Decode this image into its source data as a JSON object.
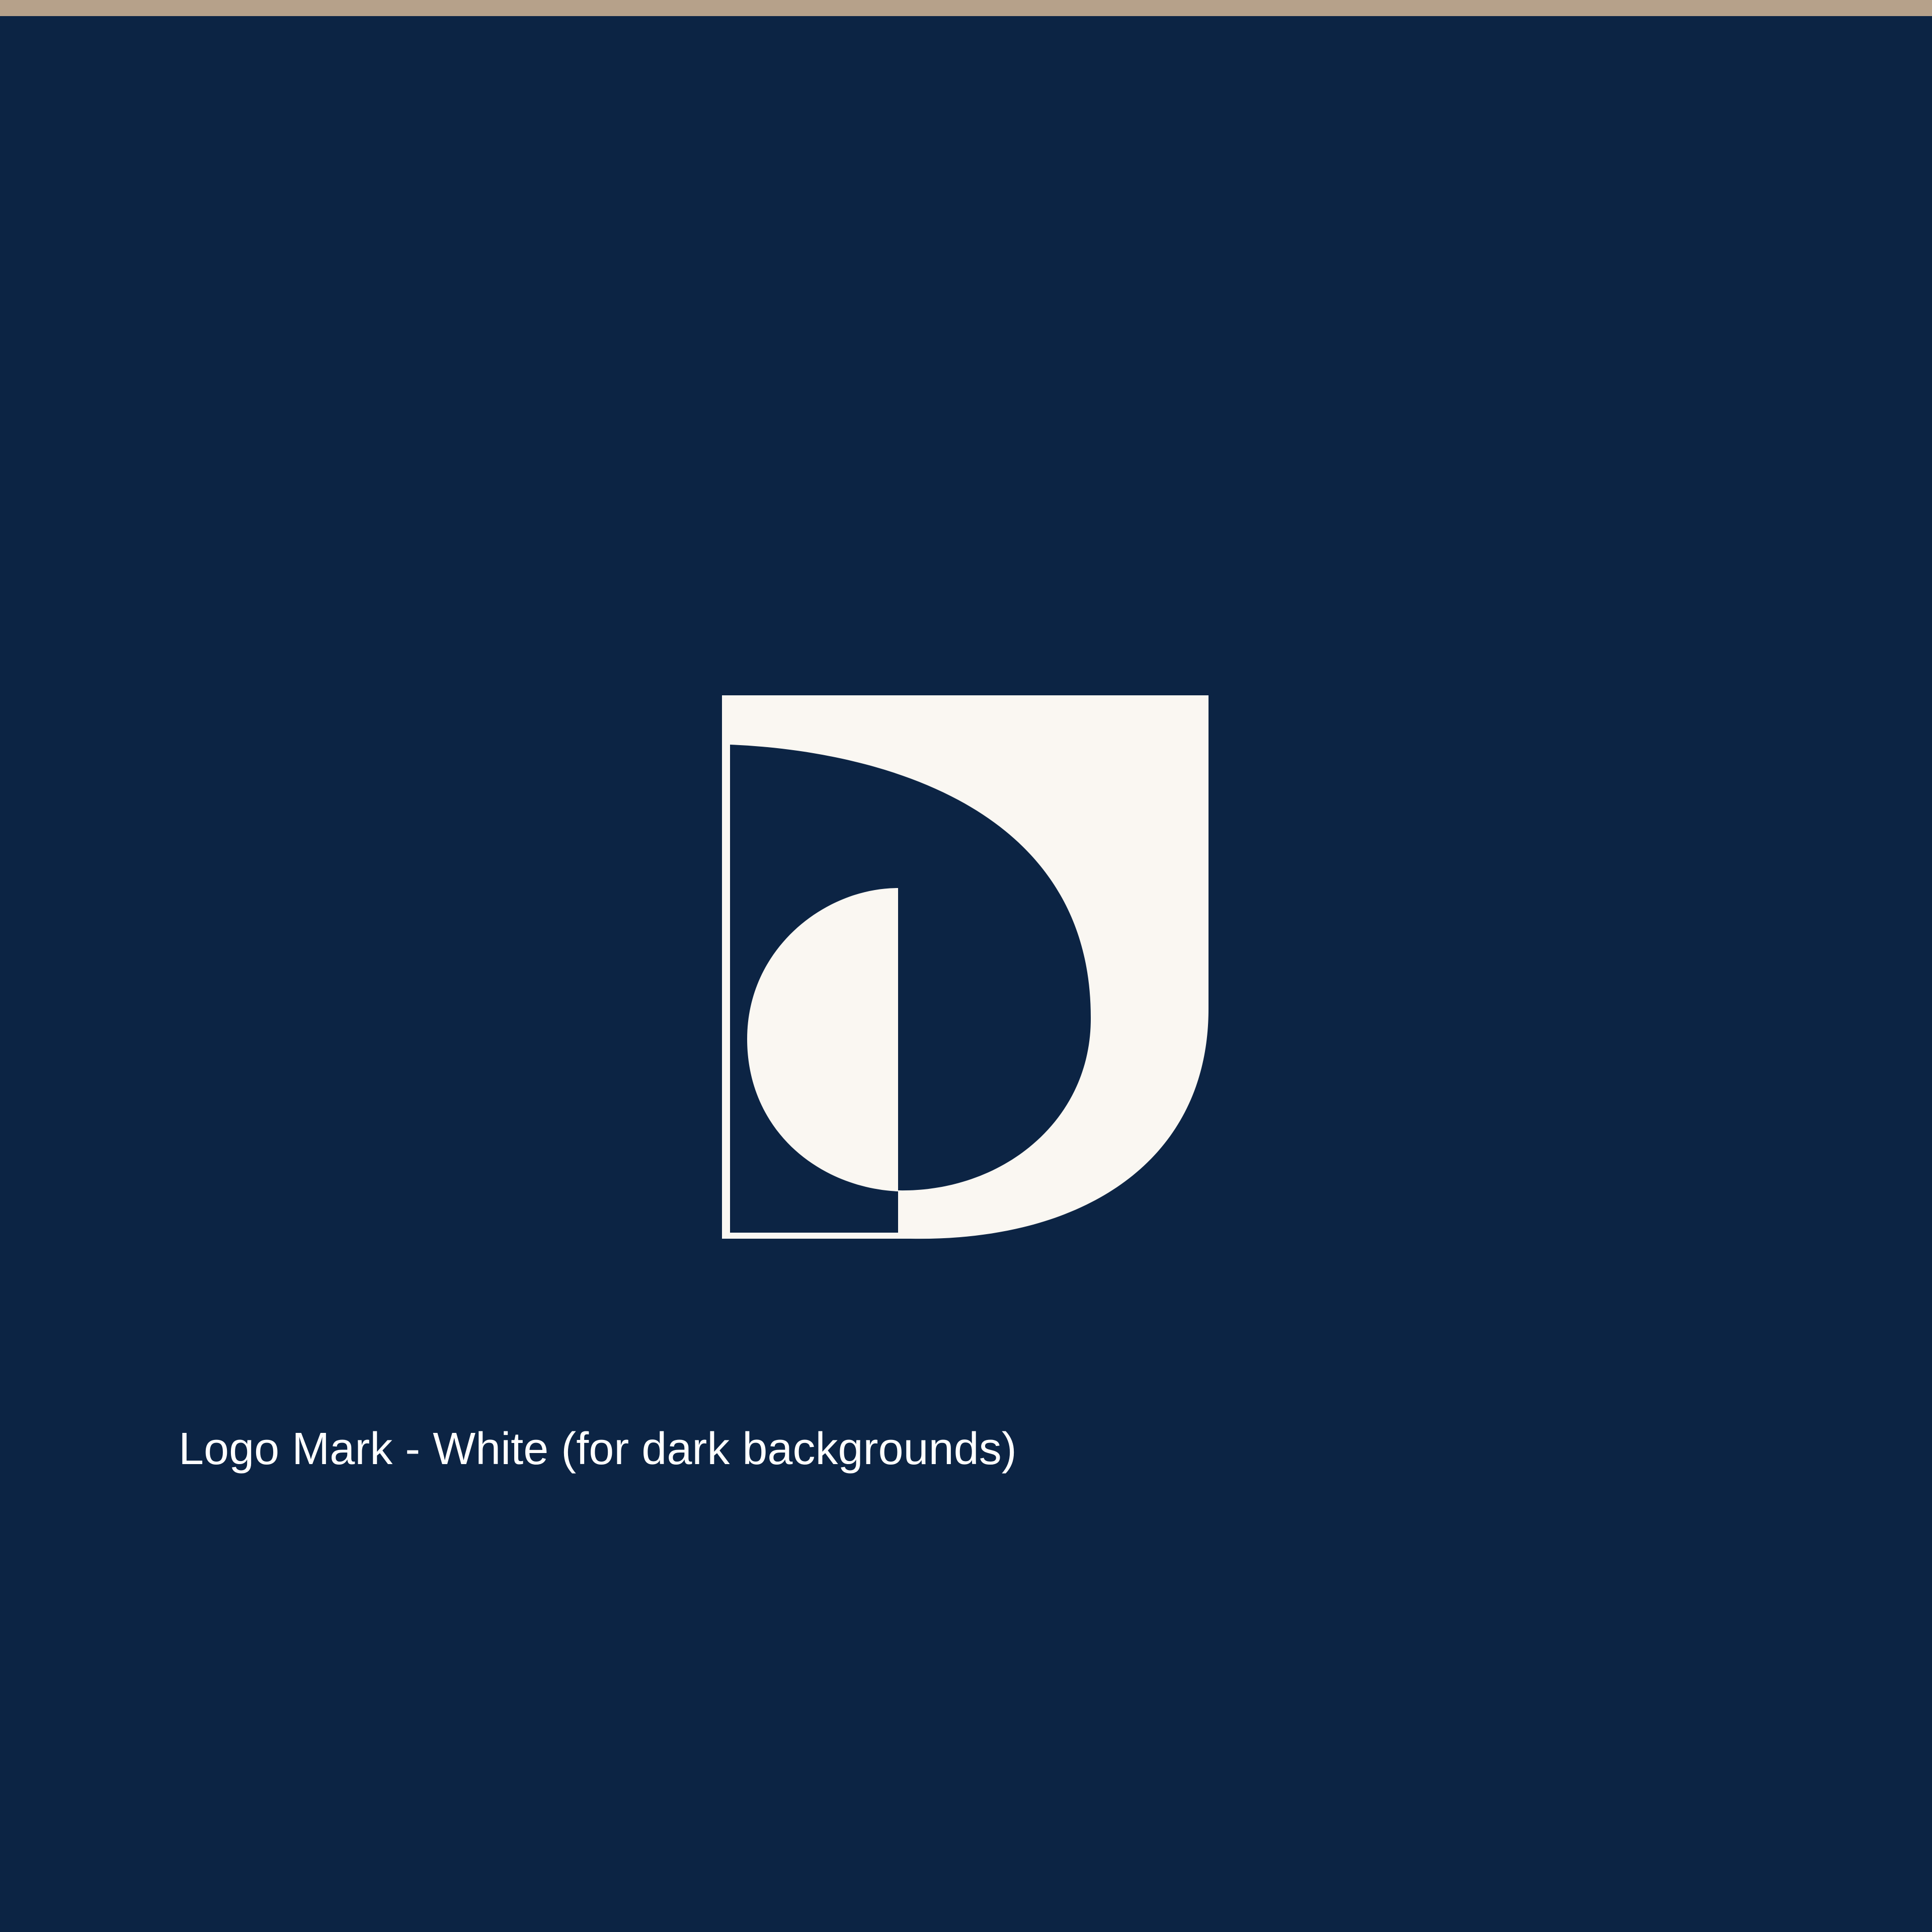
{
  "colors": {
    "background": "#0c2444",
    "accent_bar": "#b6a18a",
    "logo_fill": "#faf7f2",
    "caption_text": "#ffffff"
  },
  "logo": {
    "name": "logo-mark",
    "variant": "white"
  },
  "caption": {
    "text": "Logo Mark - White (for dark backgrounds)"
  }
}
